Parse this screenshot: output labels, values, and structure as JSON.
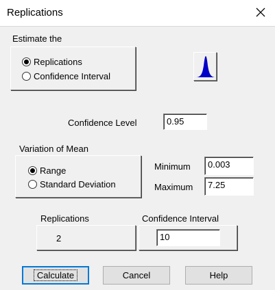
{
  "window": {
    "title": "Replications"
  },
  "estimate": {
    "label": "Estimate the",
    "options": [
      "Replications",
      "Confidence Interval"
    ],
    "selected": "Replications"
  },
  "confidence_level": {
    "label": "Confidence Level",
    "value": "0.95"
  },
  "variation": {
    "label": "Variation of Mean",
    "options": [
      "Range",
      "Standard Deviation"
    ],
    "selected": "Range",
    "minimum_label": "Minimum",
    "minimum_value": "0.003",
    "maximum_label": "Maximum",
    "maximum_value": "7.25"
  },
  "results": {
    "replications_label": "Replications",
    "replications_value": "2",
    "ci_label": "Confidence Interval",
    "ci_value": "10"
  },
  "buttons": {
    "calculate": "Calculate",
    "cancel": "Cancel",
    "help": "Help"
  },
  "icons": {
    "close": "close-icon",
    "distribution": "normal-distribution-icon"
  },
  "colors": {
    "distribution_fill": "#0000c8",
    "default_button_border": "#0078d7"
  }
}
